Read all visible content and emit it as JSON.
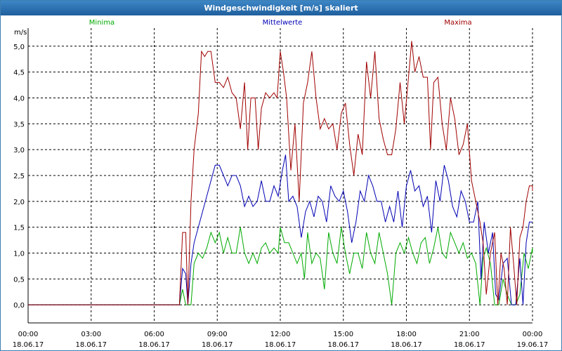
{
  "window": {
    "title": "Windgeschwindigkeit [m/s] skaliert"
  },
  "colors": {
    "min": "#00aa00",
    "mean": "#0000b4",
    "max": "#a00000",
    "grid": "#000000"
  },
  "chart_data": {
    "type": "line",
    "title": "Windgeschwindigkeit [m/s] skaliert",
    "ylabel": "m/s",
    "xlabel": "",
    "xlim": [
      0,
      24
    ],
    "ylim": [
      -0.35,
      5.35
    ],
    "grid": true,
    "legend_position": "top",
    "y_ticks": [
      {
        "v": 0.0,
        "label": "0,0"
      },
      {
        "v": 0.5,
        "label": "0,5"
      },
      {
        "v": 1.0,
        "label": "1,0"
      },
      {
        "v": 1.5,
        "label": "1,5"
      },
      {
        "v": 2.0,
        "label": "2,0"
      },
      {
        "v": 2.5,
        "label": "2,5"
      },
      {
        "v": 3.0,
        "label": "3,0"
      },
      {
        "v": 3.5,
        "label": "3,5"
      },
      {
        "v": 4.0,
        "label": "4,0"
      },
      {
        "v": 4.5,
        "label": "4,5"
      },
      {
        "v": 5.0,
        "label": "5,0"
      }
    ],
    "x_ticks": [
      {
        "v": 0,
        "time": "00:00",
        "date": "18.06.17"
      },
      {
        "v": 3,
        "time": "03:00",
        "date": "18.06.17"
      },
      {
        "v": 6,
        "time": "06:00",
        "date": "18.06.17"
      },
      {
        "v": 9,
        "time": "09:00",
        "date": "18.06.17"
      },
      {
        "v": 12,
        "time": "12:00",
        "date": "18.06.17"
      },
      {
        "v": 15,
        "time": "15:00",
        "date": "18.06.17"
      },
      {
        "v": 18,
        "time": "18:00",
        "date": "18.06.17"
      },
      {
        "v": 21,
        "time": "21:00",
        "date": "18.06.17"
      },
      {
        "v": 24,
        "time": "00:00",
        "date": "19.06.17"
      }
    ],
    "series": [
      {
        "name": "Minima",
        "color": "#00aa00",
        "points": [
          [
            0,
            0
          ],
          [
            7.2,
            0
          ],
          [
            7.35,
            0.3
          ],
          [
            7.5,
            0
          ],
          [
            7.75,
            0
          ],
          [
            7.9,
            0.8
          ],
          [
            8.1,
            1.0
          ],
          [
            8.3,
            0.9
          ],
          [
            8.5,
            1.1
          ],
          [
            8.7,
            1.4
          ],
          [
            8.9,
            1.2
          ],
          [
            9.1,
            1.4
          ],
          [
            9.3,
            1.0
          ],
          [
            9.5,
            1.3
          ],
          [
            9.7,
            1.0
          ],
          [
            9.9,
            1.0
          ],
          [
            10.1,
            1.5
          ],
          [
            10.3,
            1.0
          ],
          [
            10.5,
            0.8
          ],
          [
            10.7,
            1.0
          ],
          [
            10.9,
            0.8
          ],
          [
            11.1,
            1.1
          ],
          [
            11.3,
            1.2
          ],
          [
            11.5,
            1.0
          ],
          [
            11.7,
            1.1
          ],
          [
            11.9,
            1.0
          ],
          [
            12.0,
            1.5
          ],
          [
            12.2,
            1.2
          ],
          [
            12.4,
            1.2
          ],
          [
            12.6,
            1.0
          ],
          [
            12.8,
            0.8
          ],
          [
            13.0,
            1.0
          ],
          [
            13.15,
            0.5
          ],
          [
            13.3,
            1.4
          ],
          [
            13.5,
            0.8
          ],
          [
            13.7,
            1.0
          ],
          [
            13.9,
            0.9
          ],
          [
            14.1,
            0.3
          ],
          [
            14.3,
            1.4
          ],
          [
            14.5,
            1.0
          ],
          [
            14.7,
            0.8
          ],
          [
            14.9,
            1.5
          ],
          [
            15.1,
            1.0
          ],
          [
            15.3,
            0.6
          ],
          [
            15.5,
            1.0
          ],
          [
            15.7,
            1.0
          ],
          [
            15.9,
            0.7
          ],
          [
            16.1,
            1.4
          ],
          [
            16.3,
            1.0
          ],
          [
            16.5,
            0.8
          ],
          [
            16.7,
            1.4
          ],
          [
            16.9,
            1.0
          ],
          [
            17.1,
            0.6
          ],
          [
            17.3,
            0.0
          ],
          [
            17.5,
            1.0
          ],
          [
            17.7,
            1.2
          ],
          [
            17.9,
            1.0
          ],
          [
            18.1,
            1.3
          ],
          [
            18.3,
            1.0
          ],
          [
            18.5,
            0.8
          ],
          [
            18.7,
            1.2
          ],
          [
            18.9,
            1.3
          ],
          [
            19.1,
            0.8
          ],
          [
            19.3,
            1.1
          ],
          [
            19.5,
            1.5
          ],
          [
            19.7,
            1.0
          ],
          [
            19.9,
            0.9
          ],
          [
            20.1,
            1.4
          ],
          [
            20.3,
            1.2
          ],
          [
            20.5,
            1.0
          ],
          [
            20.7,
            1.2
          ],
          [
            20.9,
            0.9
          ],
          [
            21.1,
            1.0
          ],
          [
            21.3,
            0.8
          ],
          [
            21.5,
            0.0
          ],
          [
            21.65,
            0.9
          ],
          [
            21.8,
            1.1
          ],
          [
            22.0,
            0.8
          ],
          [
            22.2,
            0.0
          ],
          [
            22.4,
            0.0
          ],
          [
            22.6,
            0.5
          ],
          [
            22.8,
            0.2
          ],
          [
            23.0,
            0.0
          ],
          [
            23.2,
            0.0
          ],
          [
            23.4,
            0.2
          ],
          [
            23.6,
            1.0
          ],
          [
            23.8,
            0.7
          ],
          [
            24.0,
            1.1
          ],
          [
            24.0,
            1.0
          ]
        ]
      },
      {
        "name": "Mittelwerte",
        "color": "#0000b4",
        "points": [
          [
            0,
            0
          ],
          [
            7.2,
            0
          ],
          [
            7.35,
            0.7
          ],
          [
            7.5,
            0.6
          ],
          [
            7.6,
            0.0
          ],
          [
            7.75,
            0.8
          ],
          [
            7.9,
            1.2
          ],
          [
            8.1,
            1.5
          ],
          [
            8.3,
            1.8
          ],
          [
            8.5,
            2.1
          ],
          [
            8.7,
            2.4
          ],
          [
            8.9,
            2.7
          ],
          [
            9.1,
            2.7
          ],
          [
            9.3,
            2.5
          ],
          [
            9.5,
            2.3
          ],
          [
            9.7,
            2.5
          ],
          [
            9.9,
            2.5
          ],
          [
            10.1,
            2.3
          ],
          [
            10.3,
            1.9
          ],
          [
            10.5,
            2.1
          ],
          [
            10.7,
            1.9
          ],
          [
            10.9,
            2.0
          ],
          [
            11.1,
            2.4
          ],
          [
            11.3,
            2.0
          ],
          [
            11.5,
            2.0
          ],
          [
            11.7,
            2.3
          ],
          [
            11.9,
            2.1
          ],
          [
            12.1,
            2.6
          ],
          [
            12.25,
            2.9
          ],
          [
            12.4,
            2.0
          ],
          [
            12.6,
            2.1
          ],
          [
            12.8,
            1.9
          ],
          [
            13.0,
            1.3
          ],
          [
            13.2,
            1.8
          ],
          [
            13.4,
            2.0
          ],
          [
            13.6,
            1.7
          ],
          [
            13.8,
            2.1
          ],
          [
            14.0,
            2.0
          ],
          [
            14.2,
            1.6
          ],
          [
            14.4,
            2.3
          ],
          [
            14.6,
            2.1
          ],
          [
            14.8,
            2.0
          ],
          [
            15.0,
            2.2
          ],
          [
            15.2,
            1.8
          ],
          [
            15.4,
            1.2
          ],
          [
            15.6,
            1.6
          ],
          [
            15.8,
            2.2
          ],
          [
            16.0,
            2.0
          ],
          [
            16.2,
            2.5
          ],
          [
            16.4,
            2.3
          ],
          [
            16.6,
            2.0
          ],
          [
            16.8,
            2.0
          ],
          [
            17.0,
            1.6
          ],
          [
            17.2,
            1.9
          ],
          [
            17.4,
            1.6
          ],
          [
            17.6,
            2.2
          ],
          [
            17.8,
            1.5
          ],
          [
            18.0,
            2.3
          ],
          [
            18.2,
            2.6
          ],
          [
            18.4,
            2.2
          ],
          [
            18.6,
            2.3
          ],
          [
            18.8,
            1.9
          ],
          [
            19.0,
            2.1
          ],
          [
            19.2,
            1.4
          ],
          [
            19.4,
            2.4
          ],
          [
            19.6,
            2.0
          ],
          [
            19.8,
            2.7
          ],
          [
            20.0,
            2.4
          ],
          [
            20.2,
            1.9
          ],
          [
            20.4,
            1.7
          ],
          [
            20.6,
            2.2
          ],
          [
            20.8,
            2.0
          ],
          [
            21.0,
            1.6
          ],
          [
            21.2,
            1.6
          ],
          [
            21.4,
            2.0
          ],
          [
            21.55,
            0.5
          ],
          [
            21.7,
            1.6
          ],
          [
            21.9,
            1.0
          ],
          [
            22.1,
            1.4
          ],
          [
            22.25,
            0.2
          ],
          [
            22.4,
            0.1
          ],
          [
            22.6,
            0.8
          ],
          [
            22.8,
            0.9
          ],
          [
            23.0,
            0.0
          ],
          [
            23.2,
            0.0
          ],
          [
            23.4,
            0.9
          ],
          [
            23.55,
            0.0
          ],
          [
            23.7,
            1.2
          ],
          [
            23.85,
            1.6
          ],
          [
            24.0,
            1.6
          ],
          [
            24.0,
            1.6
          ]
        ]
      },
      {
        "name": "Maxima",
        "color": "#a00000",
        "points": [
          [
            0,
            0
          ],
          [
            7.2,
            0
          ],
          [
            7.35,
            1.4
          ],
          [
            7.5,
            1.4
          ],
          [
            7.6,
            0.0
          ],
          [
            7.75,
            2.0
          ],
          [
            7.9,
            3.0
          ],
          [
            8.1,
            3.7
          ],
          [
            8.25,
            4.9
          ],
          [
            8.4,
            4.8
          ],
          [
            8.55,
            4.9
          ],
          [
            8.7,
            4.9
          ],
          [
            8.9,
            4.3
          ],
          [
            9.1,
            4.3
          ],
          [
            9.3,
            4.2
          ],
          [
            9.5,
            4.4
          ],
          [
            9.7,
            4.1
          ],
          [
            9.9,
            4.0
          ],
          [
            10.1,
            3.4
          ],
          [
            10.3,
            4.3
          ],
          [
            10.45,
            3.0
          ],
          [
            10.6,
            4.0
          ],
          [
            10.8,
            4.0
          ],
          [
            10.95,
            3.0
          ],
          [
            11.1,
            3.8
          ],
          [
            11.3,
            4.1
          ],
          [
            11.5,
            4.0
          ],
          [
            11.7,
            4.1
          ],
          [
            11.85,
            4.0
          ],
          [
            12.0,
            4.9
          ],
          [
            12.15,
            4.5
          ],
          [
            12.3,
            4.0
          ],
          [
            12.5,
            2.6
          ],
          [
            12.7,
            3.5
          ],
          [
            12.9,
            2.0
          ],
          [
            13.1,
            3.9
          ],
          [
            13.3,
            4.3
          ],
          [
            13.5,
            4.9
          ],
          [
            13.7,
            4.0
          ],
          [
            13.9,
            3.4
          ],
          [
            14.1,
            3.6
          ],
          [
            14.3,
            3.4
          ],
          [
            14.5,
            3.5
          ],
          [
            14.7,
            3.0
          ],
          [
            14.9,
            3.7
          ],
          [
            15.1,
            3.9
          ],
          [
            15.3,
            3.1
          ],
          [
            15.5,
            2.5
          ],
          [
            15.7,
            3.3
          ],
          [
            15.9,
            2.9
          ],
          [
            16.1,
            4.7
          ],
          [
            16.3,
            4.0
          ],
          [
            16.5,
            4.9
          ],
          [
            16.7,
            3.6
          ],
          [
            16.9,
            3.2
          ],
          [
            17.1,
            2.9
          ],
          [
            17.3,
            2.9
          ],
          [
            17.5,
            3.4
          ],
          [
            17.7,
            4.3
          ],
          [
            17.9,
            3.5
          ],
          [
            18.1,
            4.4
          ],
          [
            18.25,
            5.1
          ],
          [
            18.4,
            4.5
          ],
          [
            18.6,
            4.8
          ],
          [
            18.8,
            4.4
          ],
          [
            19.0,
            4.4
          ],
          [
            19.15,
            3.0
          ],
          [
            19.3,
            4.3
          ],
          [
            19.5,
            4.4
          ],
          [
            19.7,
            3.5
          ],
          [
            19.9,
            3.0
          ],
          [
            20.1,
            4.0
          ],
          [
            20.3,
            3.6
          ],
          [
            20.5,
            2.9
          ],
          [
            20.7,
            3.1
          ],
          [
            20.9,
            3.5
          ],
          [
            21.1,
            2.4
          ],
          [
            21.3,
            2.0
          ],
          [
            21.5,
            1.6
          ],
          [
            21.65,
            1.2
          ],
          [
            21.8,
            0.2
          ],
          [
            22.0,
            1.0
          ],
          [
            22.2,
            1.4
          ],
          [
            22.35,
            0.0
          ],
          [
            22.5,
            1.0
          ],
          [
            22.65,
            0.7
          ],
          [
            22.8,
            0.0
          ],
          [
            22.95,
            1.5
          ],
          [
            23.1,
            0.8
          ],
          [
            23.25,
            0.0
          ],
          [
            23.4,
            1.3
          ],
          [
            23.55,
            1.5
          ],
          [
            23.7,
            2.0
          ],
          [
            23.85,
            2.3
          ],
          [
            24.0,
            2.3
          ],
          [
            24.0,
            2.2
          ]
        ]
      }
    ]
  }
}
